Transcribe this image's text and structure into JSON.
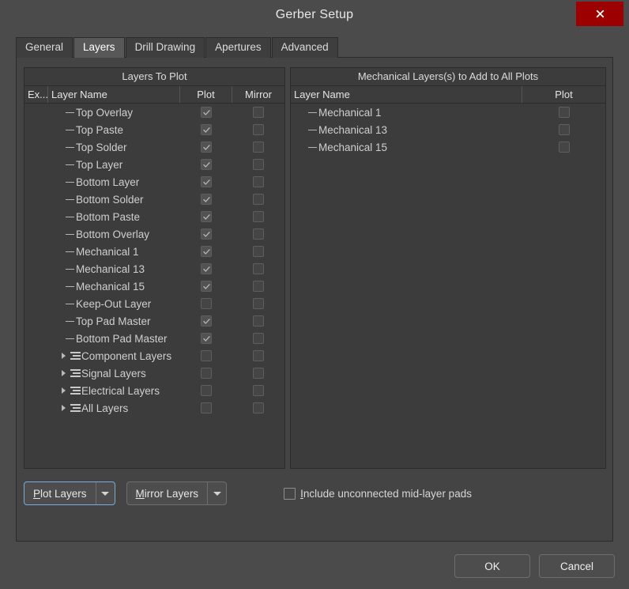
{
  "window": {
    "title": "Gerber Setup",
    "close_label": "×",
    "close_icon": "close-icon"
  },
  "tabs": [
    {
      "label": "General",
      "active": false
    },
    {
      "label": "Layers",
      "active": true
    },
    {
      "label": "Drill Drawing",
      "active": false
    },
    {
      "label": "Apertures",
      "active": false
    },
    {
      "label": "Advanced",
      "active": false
    }
  ],
  "left_panel": {
    "caption": "Layers To Plot",
    "columns": [
      "Ex...",
      "Layer Name",
      "Plot",
      "Mirror"
    ],
    "rows": [
      {
        "name": "Top Overlay",
        "type": "leaf",
        "plot": true,
        "mirror": false
      },
      {
        "name": "Top Paste",
        "type": "leaf",
        "plot": true,
        "mirror": false
      },
      {
        "name": "Top Solder",
        "type": "leaf",
        "plot": true,
        "mirror": false
      },
      {
        "name": "Top Layer",
        "type": "leaf",
        "plot": true,
        "mirror": false
      },
      {
        "name": "Bottom Layer",
        "type": "leaf",
        "plot": true,
        "mirror": false
      },
      {
        "name": "Bottom Solder",
        "type": "leaf",
        "plot": true,
        "mirror": false
      },
      {
        "name": "Bottom Paste",
        "type": "leaf",
        "plot": true,
        "mirror": false
      },
      {
        "name": "Bottom Overlay",
        "type": "leaf",
        "plot": true,
        "mirror": false
      },
      {
        "name": "Mechanical 1",
        "type": "leaf",
        "plot": true,
        "mirror": false
      },
      {
        "name": "Mechanical 13",
        "type": "leaf",
        "plot": true,
        "mirror": false
      },
      {
        "name": "Mechanical 15",
        "type": "leaf",
        "plot": true,
        "mirror": false
      },
      {
        "name": "Keep-Out Layer",
        "type": "leaf",
        "plot": false,
        "mirror": false
      },
      {
        "name": "Top Pad Master",
        "type": "leaf",
        "plot": true,
        "mirror": false
      },
      {
        "name": "Bottom Pad Master",
        "type": "leaf",
        "plot": true,
        "mirror": false
      },
      {
        "name": "Component Layers",
        "type": "group",
        "plot": false,
        "mirror": false
      },
      {
        "name": "Signal Layers",
        "type": "group",
        "plot": false,
        "mirror": false
      },
      {
        "name": "Electrical Layers",
        "type": "group",
        "plot": false,
        "mirror": false
      },
      {
        "name": "All Layers",
        "type": "group",
        "plot": false,
        "mirror": false
      }
    ]
  },
  "right_panel": {
    "caption": "Mechanical Layers(s) to Add to All Plots",
    "columns": [
      "Layer Name",
      "Plot"
    ],
    "rows": [
      {
        "name": "Mechanical 1",
        "type": "leaf",
        "plot": false
      },
      {
        "name": "Mechanical 13",
        "type": "leaf",
        "plot": false
      },
      {
        "name": "Mechanical 15",
        "type": "leaf",
        "plot": false
      }
    ]
  },
  "controls": {
    "plot_layers": {
      "mnemonic": "P",
      "rest": "lot Layers",
      "focused": true
    },
    "mirror_layers": {
      "mnemonic": "M",
      "rest": "irror Layers",
      "focused": false
    },
    "include_option": {
      "mnemonic": "I",
      "rest": "nclude unconnected mid-layer pads",
      "checked": false
    }
  },
  "footer": {
    "ok_label": "OK",
    "cancel_label": "Cancel"
  },
  "colors": {
    "window_bg": "#4b4b4b",
    "panel_bg": "#3c3c3c",
    "tabpanel_bg": "#444444",
    "close_red": "#9d0000",
    "active_tab": "#585858",
    "focus_blue": "#7fa8d8",
    "text": "#dcdcdc"
  }
}
